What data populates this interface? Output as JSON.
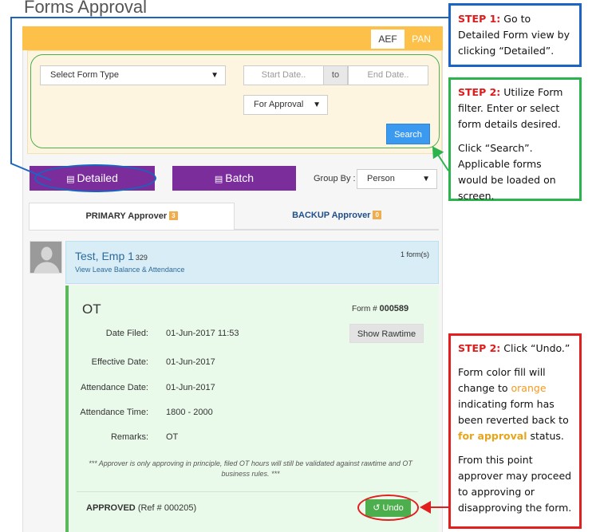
{
  "page": {
    "title": "Forms Approval"
  },
  "top_tabs": [
    {
      "label": "AEF"
    },
    {
      "label": "PAN"
    }
  ],
  "filter": {
    "form_type": "Select Form Type",
    "start_date_placeholder": "Start Date..",
    "to_label": "to",
    "end_date_placeholder": "End Date..",
    "status": "For Approval",
    "search_label": "Search"
  },
  "view_buttons": {
    "detailed": "Detailed",
    "batch": "Batch"
  },
  "group_by": {
    "label": "Group By :",
    "value": "Person"
  },
  "approver_tabs": {
    "primary": {
      "label": "PRIMARY Approver",
      "count": "3"
    },
    "backup": {
      "label": "BACKUP Approver",
      "count": "0"
    }
  },
  "employee": {
    "name": "Test, Emp 1",
    "id": "329",
    "link": "View Leave Balance & Attendance",
    "form_count": "1 form(s)"
  },
  "form": {
    "type": "OT",
    "form_no_label": "Form #",
    "form_no": "000589",
    "rawtime_label": "Show Rawtime",
    "fields": [
      {
        "label": "Date Filed:",
        "value": "01-Jun-2017 11:53"
      },
      {
        "label": "Effective Date:",
        "value": "01-Jun-2017"
      },
      {
        "label": "Attendance Date:",
        "value": "01-Jun-2017"
      },
      {
        "label": "Attendance Time:",
        "value": "1800 - 2000"
      },
      {
        "label": "Remarks:",
        "value": "OT"
      }
    ],
    "note": "*** Approver is only approving in principle, filed OT hours will still be validated against rawtime and OT business rules. ***",
    "status": "APPROVED",
    "ref": "(Ref # 000205)",
    "undo_label": "Undo"
  },
  "callouts": {
    "step1": {
      "tag": "STEP 1:",
      "text": "Go to Detailed Form view by clicking “Detailed”."
    },
    "step2": {
      "tag": "STEP 2:",
      "text": "Utilize Form filter. Enter or select form details desired.",
      "text2": "Click “Search”. Applicable forms would be loaded on screen."
    },
    "step3": {
      "tag": "STEP 2:",
      "text": "Click “Undo.”",
      "p2_a": "Form color fill will change to",
      "p2_orange": "orange",
      "p2_b": "indicating form has been reverted back to",
      "p2_gold": "for approval",
      "p2_c": "status.",
      "p3": "From this point approver may proceed to approving or disapproving the form."
    }
  },
  "colors": {
    "accent_orange": "#fdc14a",
    "purple": "#7b2d9c",
    "search_blue": "#3b9af0",
    "approved_green": "#5cb85c",
    "callout_blue": "#1b64c3",
    "callout_green": "#2bb34d",
    "callout_red": "#e31e1e"
  }
}
